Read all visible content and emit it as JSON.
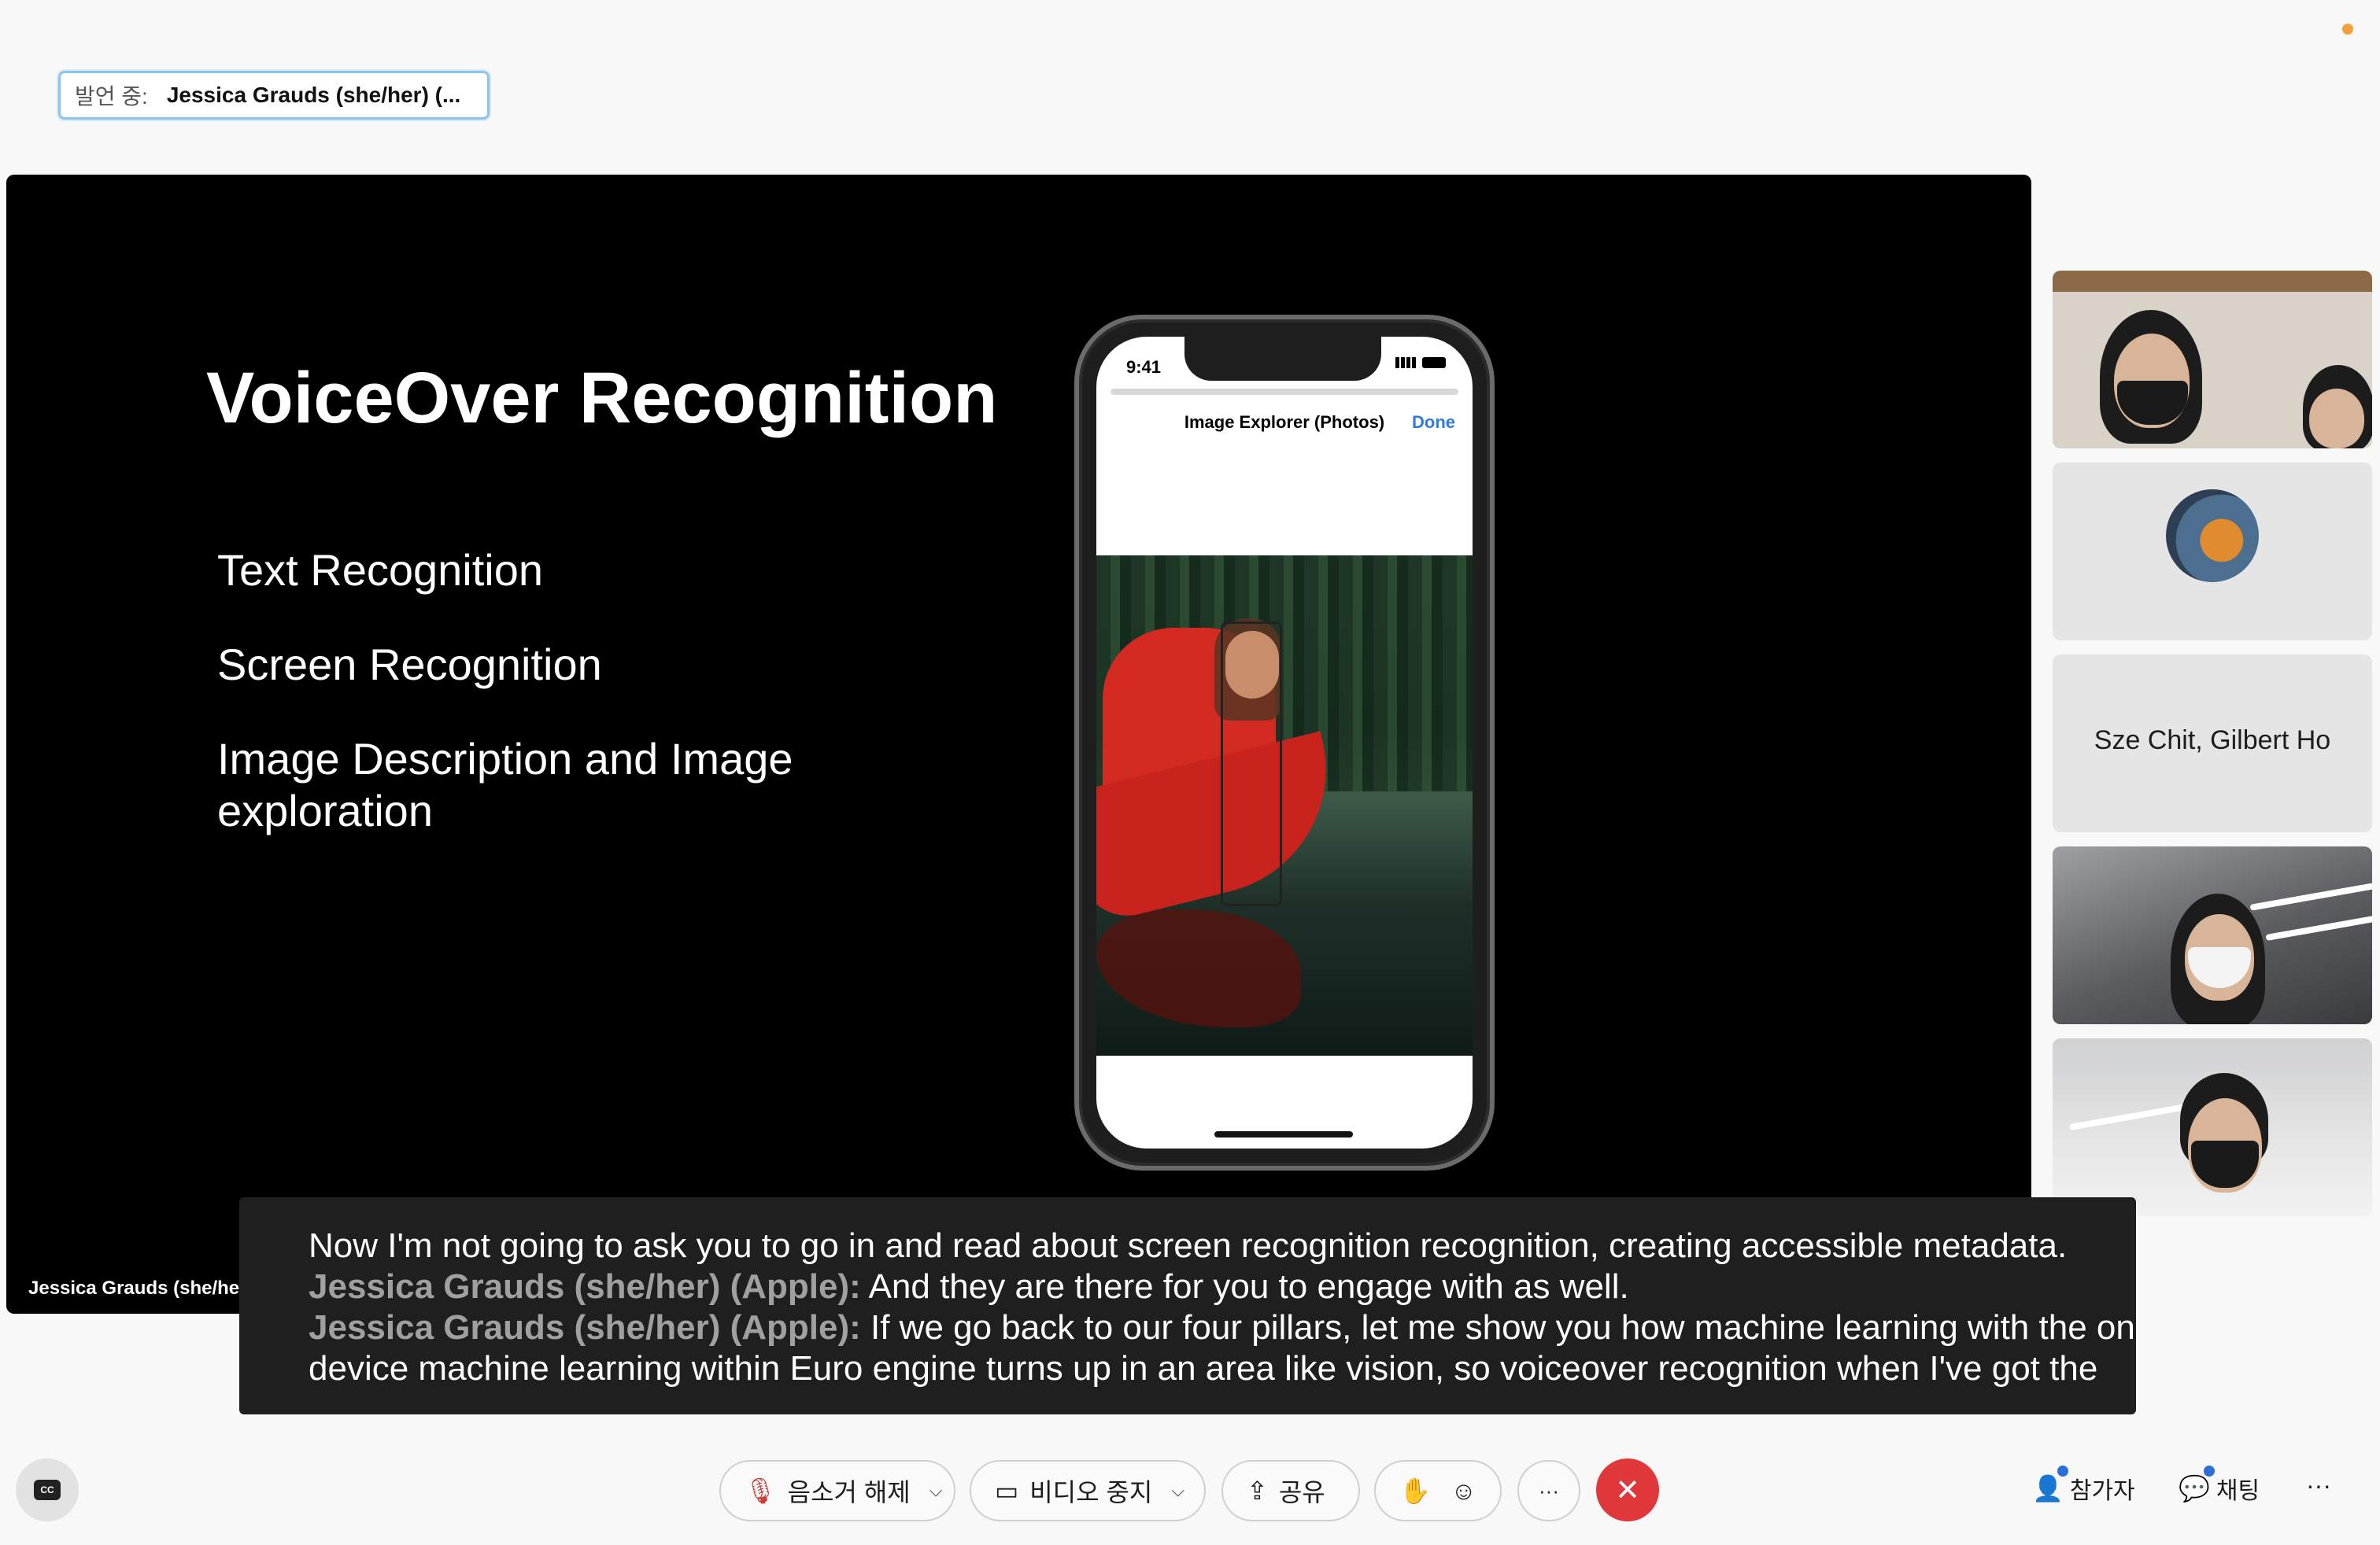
{
  "speaking": {
    "label": "발언 중:",
    "name": "Jessica Grauds (she/her) (..."
  },
  "slide": {
    "title": "VoiceOver Recognition",
    "bullets": [
      "Text Recognition",
      "Screen Recognition",
      "Image Description and Image exploration"
    ]
  },
  "phone": {
    "time": "9:41",
    "nav_title": "Image Explorer (Photos)",
    "done_label": "Done"
  },
  "stage_name": "Jessica Grauds (she/her",
  "participants": [
    {
      "id": "p1",
      "type": "video"
    },
    {
      "id": "p2",
      "type": "avatar"
    },
    {
      "id": "p3",
      "type": "name",
      "name": "Sze Chit, Gilbert Ho"
    },
    {
      "id": "p4",
      "type": "video"
    },
    {
      "id": "p5",
      "type": "video"
    }
  ],
  "captions": [
    {
      "speaker": "",
      "text": "Now I'm not going to ask you to go in and read about screen recognition recognition, creating accessible metadata."
    },
    {
      "speaker": "Jessica Grauds (she/her) (Apple):",
      "text": " And they are there for you to engage with as well."
    },
    {
      "speaker": "Jessica Grauds (she/her) (Apple):",
      "text": " If we go back to our four pillars, let me show you how machine learning with the on"
    },
    {
      "speaker": "",
      "text": "device machine learning within Euro engine turns up in an area like vision, so voiceover recognition when I've got the"
    }
  ],
  "toolbar": {
    "cc_label": "CC",
    "mute_label": "음소거 해제",
    "video_label": "비디오 중지",
    "share_label": "공유",
    "more_label": "···",
    "participants_label": "참가자",
    "chat_label": "채팅",
    "overflow_label": "···"
  },
  "colors": {
    "accent": "#2b6fd6",
    "end_call": "#e0383a",
    "status_dot": "#f0a03c"
  }
}
